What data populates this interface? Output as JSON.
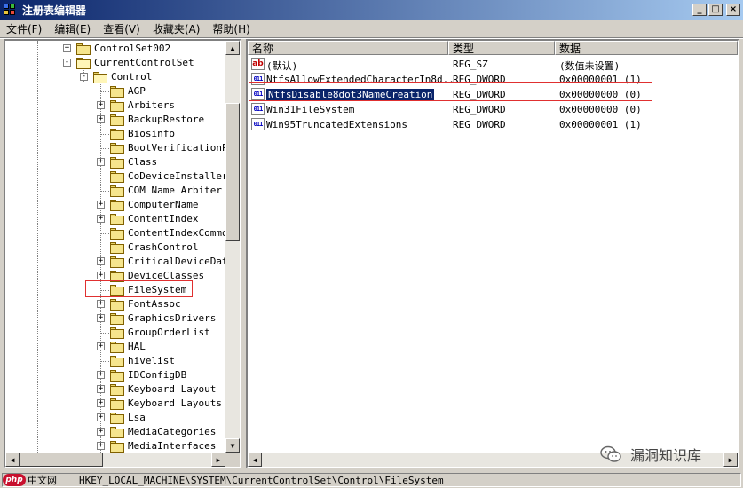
{
  "window": {
    "title": "注册表编辑器",
    "buttons": {
      "minimize": "_",
      "maximize": "□",
      "close": "×"
    }
  },
  "menu": [
    "文件(F)",
    "编辑(E)",
    "查看(V)",
    "收藏夹(A)",
    "帮助(H)"
  ],
  "tree": {
    "items": [
      {
        "label": "ControlSet002",
        "expander": "+"
      },
      {
        "label": "CurrentControlSet",
        "expander": "-"
      },
      {
        "label": "Control",
        "expander": "-"
      },
      {
        "label": "AGP",
        "expander": ""
      },
      {
        "label": "Arbiters",
        "expander": "+"
      },
      {
        "label": "BackupRestore",
        "expander": "+"
      },
      {
        "label": "Biosinfo",
        "expander": ""
      },
      {
        "label": "BootVerificationPro",
        "expander": ""
      },
      {
        "label": "Class",
        "expander": "+"
      },
      {
        "label": "CoDeviceInstallers",
        "expander": ""
      },
      {
        "label": "COM Name Arbiter",
        "expander": ""
      },
      {
        "label": "ComputerName",
        "expander": "+"
      },
      {
        "label": "ContentIndex",
        "expander": "+"
      },
      {
        "label": "ContentIndexCommon",
        "expander": ""
      },
      {
        "label": "CrashControl",
        "expander": ""
      },
      {
        "label": "CriticalDeviceDatal",
        "expander": "+"
      },
      {
        "label": "DeviceClasses",
        "expander": "+"
      },
      {
        "label": "FileSystem",
        "expander": ""
      },
      {
        "label": "FontAssoc",
        "expander": "+"
      },
      {
        "label": "GraphicsDrivers",
        "expander": "+"
      },
      {
        "label": "GroupOrderList",
        "expander": ""
      },
      {
        "label": "HAL",
        "expander": "+"
      },
      {
        "label": "hivelist",
        "expander": ""
      },
      {
        "label": "IDConfigDB",
        "expander": "+"
      },
      {
        "label": "Keyboard Layout",
        "expander": "+"
      },
      {
        "label": "Keyboard Layouts",
        "expander": "+"
      },
      {
        "label": "Lsa",
        "expander": "+"
      },
      {
        "label": "MediaCategories",
        "expander": "+"
      },
      {
        "label": "MediaInterfaces",
        "expander": "+"
      }
    ]
  },
  "list": {
    "columns": [
      "名称",
      "类型",
      "数据"
    ],
    "rows": [
      {
        "name": "(默认)",
        "type": "REG_SZ",
        "data": "(数值未设置)",
        "icon": "ab"
      },
      {
        "name": "NtfsAllowExtendedCharacterIn8d...",
        "type": "REG_DWORD",
        "data": "0x00000001 (1)",
        "icon": "011"
      },
      {
        "name": "NtfsDisable8dot3NameCreation",
        "type": "REG_DWORD",
        "data": "0x00000000 (0)",
        "icon": "011"
      },
      {
        "name": "Win31FileSystem",
        "type": "REG_DWORD",
        "data": "0x00000000 (0)",
        "icon": "011"
      },
      {
        "name": "Win95TruncatedExtensions",
        "type": "REG_DWORD",
        "data": "0x00000001 (1)",
        "icon": "011"
      }
    ]
  },
  "status": {
    "path": "HKEY_LOCAL_MACHINE\\SYSTEM\\CurrentControlSet\\Control\\FileSystem"
  },
  "overlay": {
    "php_badge": "php",
    "php_text": "中文网",
    "watermark": "漏洞知识库"
  },
  "scroll_arrows": {
    "up": "▲",
    "down": "▼",
    "left": "◀",
    "right": "▶"
  }
}
